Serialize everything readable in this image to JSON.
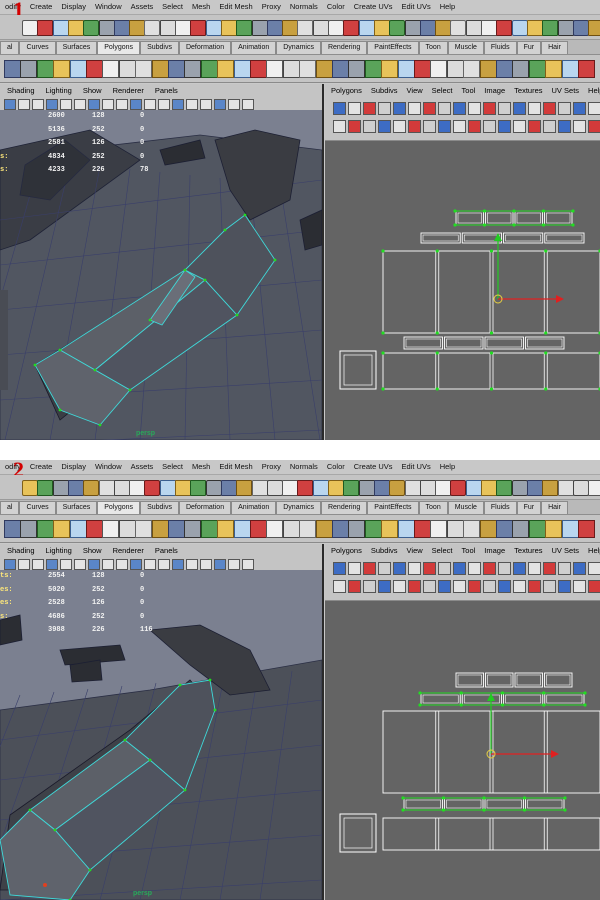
{
  "menus": [
    "odify",
    "Create",
    "Display",
    "Window",
    "Assets",
    "Select",
    "Mesh",
    "Edit Mesh",
    "Proxy",
    "Normals",
    "Color",
    "Create UVs",
    "Edit UVs",
    "Help"
  ],
  "shelf_tabs": [
    "al",
    "Curves",
    "Surfaces",
    "Polygons",
    "Subdivs",
    "Deformation",
    "Animation",
    "Dynamics",
    "Rendering",
    "PaintEffects",
    "Toon",
    "Muscle",
    "Fluids",
    "Fur",
    "Hair"
  ],
  "viewport_menu": [
    "Shading",
    "Lighting",
    "Show",
    "Renderer",
    "Panels"
  ],
  "uv_menu": [
    "Polygons",
    "Subdivs",
    "View",
    "Select",
    "Tool",
    "Image",
    "Textures",
    "UV Sets",
    "Help"
  ],
  "colors": {
    "accent_red": "#d40000",
    "wire_cyan": "#3fd9d9",
    "uv_green": "#22dd22",
    "uv_bg": "#646464",
    "vp_bg": "#7d8293"
  },
  "icons": [
    "file-icon",
    "open-icon",
    "save-icon",
    "select-tool-icon",
    "lasso-icon",
    "snap-grid-icon",
    "snap-curve-icon",
    "magnet-icon",
    "render-icon",
    "shelf-tool-icon"
  ],
  "panels": [
    {
      "step": "1",
      "hud": [
        {
          "label": "",
          "a": "2600",
          "b": "128",
          "c": "0"
        },
        {
          "label": "",
          "a": "5136",
          "b": "252",
          "c": "0"
        },
        {
          "label": "",
          "a": "2581",
          "b": "126",
          "c": "0"
        },
        {
          "label": "s:",
          "a": "4834",
          "b": "252",
          "c": "0"
        },
        {
          "label": "s:",
          "a": "4233",
          "b": "226",
          "c": "78"
        }
      ],
      "camera": "persp"
    },
    {
      "step": "2",
      "hud": [
        {
          "label": "ts:",
          "a": "2554",
          "b": "128",
          "c": "0"
        },
        {
          "label": "es:",
          "a": "5020",
          "b": "252",
          "c": "0"
        },
        {
          "label": "es:",
          "a": "2528",
          "b": "126",
          "c": "0"
        },
        {
          "label": "s:",
          "a": "4686",
          "b": "252",
          "c": "0"
        },
        {
          "label": "",
          "a": "3988",
          "b": "226",
          "c": "116"
        }
      ],
      "camera": "persp"
    }
  ]
}
